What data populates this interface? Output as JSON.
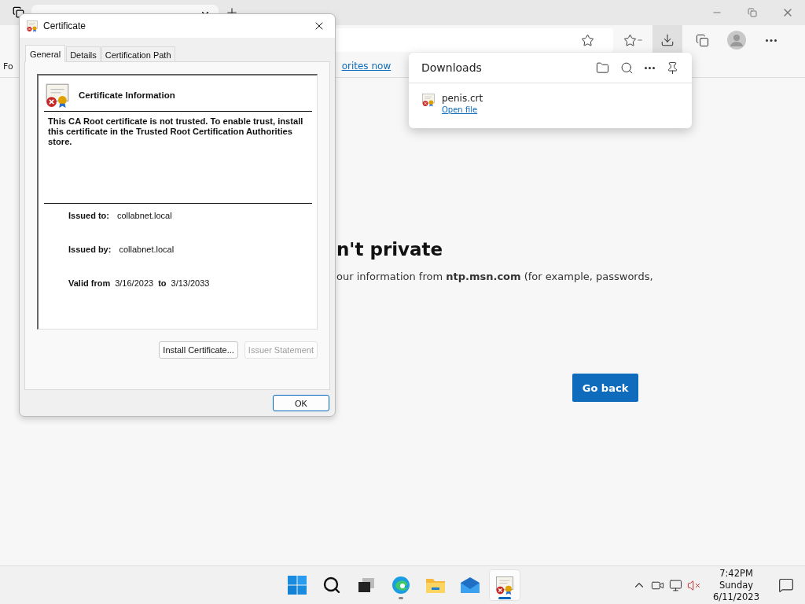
{
  "browser": {
    "toolbar_buttons": [
      {
        "kind": "add-favorite",
        "selected": false
      },
      {
        "kind": "favorites",
        "selected": false
      },
      {
        "kind": "downloads",
        "selected": true
      },
      {
        "kind": "collections",
        "selected": false
      },
      {
        "kind": "profile",
        "selected": false
      },
      {
        "kind": "more",
        "selected": false
      }
    ],
    "favorites_bar": {
      "text": "Fo",
      "link": "orites now"
    },
    "page": {
      "heading": "n't private",
      "body": "our information from **ntp.msn.com** (for example, passwords,",
      "button": "Go back"
    }
  },
  "downloads": {
    "title": "Downloads",
    "items": [
      {
        "name": "penis.crt",
        "action": "Open file"
      }
    ]
  },
  "dialog": {
    "title": "Certificate",
    "tabs": [
      {
        "label": "General",
        "selected": true
      },
      {
        "label": "Details",
        "selected": false
      },
      {
        "label": "Certification Path",
        "selected": false
      }
    ],
    "heading": "Certificate Information",
    "message": "This CA Root certificate is not trusted. To enable trust, install this certificate in the Trusted Root Certification Authorities store.",
    "fields": [
      {
        "label": "Issued to:",
        "value": "collabnet.local"
      },
      {
        "label": "Issued by:",
        "value": "collabnet.local"
      }
    ],
    "validity": {
      "label": "Valid from",
      "from": "3/16/2023",
      "to_label": "to",
      "to": "3/13/2033"
    },
    "buttons": [
      {
        "label": "Install Certificate...",
        "disabled": false
      },
      {
        "label": "Issuer Statement",
        "disabled": true
      }
    ],
    "ok": "OK"
  },
  "taskbar": {
    "apps": [
      {
        "kind": "start",
        "running": false,
        "active": false
      },
      {
        "kind": "search",
        "running": false,
        "active": false
      },
      {
        "kind": "task-view",
        "running": false,
        "active": false
      },
      {
        "kind": "edge",
        "running": true,
        "active": false
      },
      {
        "kind": "explorer",
        "running": false,
        "active": false
      },
      {
        "kind": "mail",
        "running": false,
        "active": false
      },
      {
        "kind": "certificate",
        "running": true,
        "active": true
      }
    ],
    "clock": {
      "time": "7:42PM",
      "day": "Sunday",
      "date": "6/11/2023"
    }
  }
}
